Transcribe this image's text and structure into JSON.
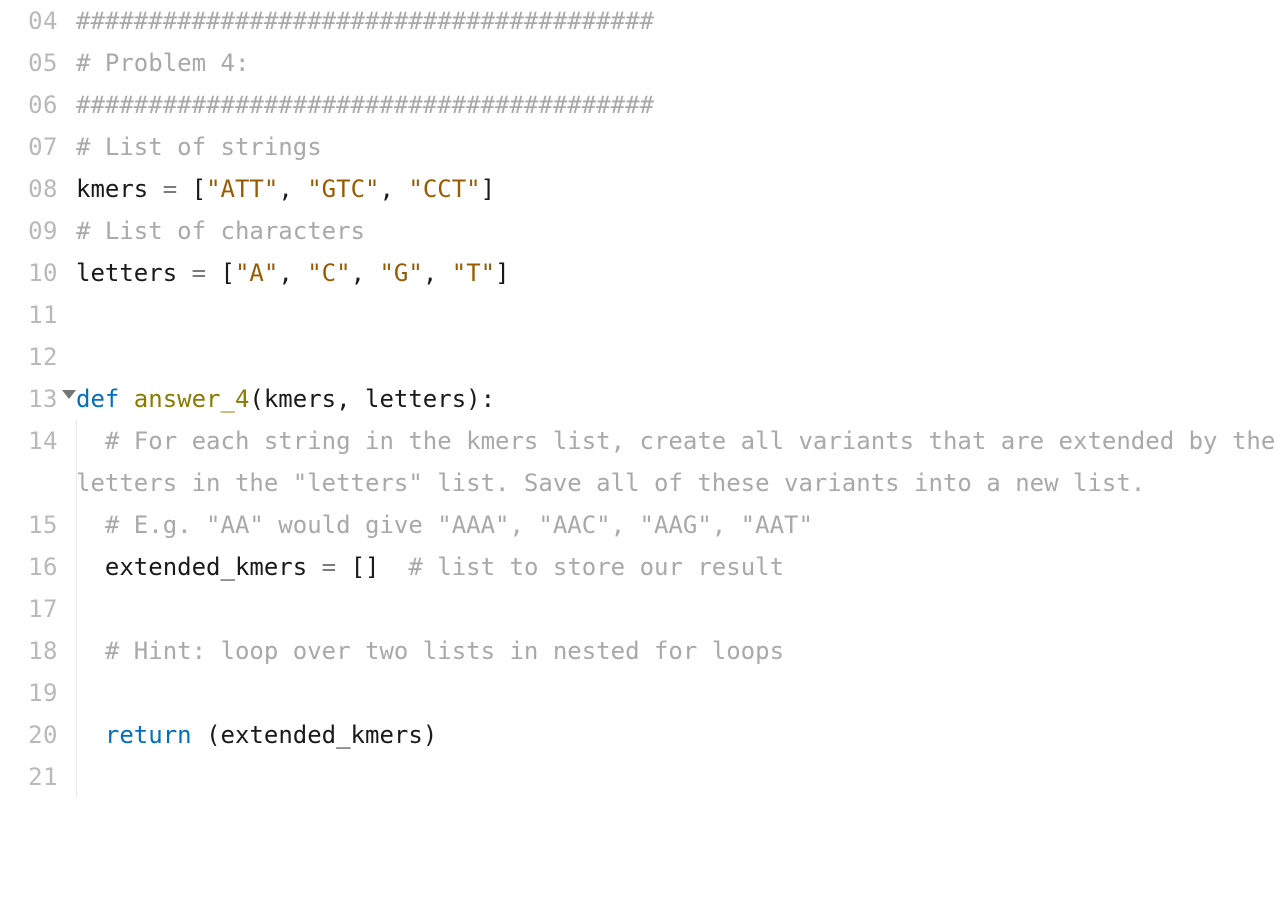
{
  "lines": [
    {
      "num": "04",
      "fold": false,
      "indent": 0,
      "tokens": [
        {
          "c": "tok-comment",
          "t": "########################################"
        }
      ]
    },
    {
      "num": "05",
      "fold": false,
      "indent": 0,
      "tokens": [
        {
          "c": "tok-comment",
          "t": "# Problem 4:"
        }
      ]
    },
    {
      "num": "06",
      "fold": false,
      "indent": 0,
      "tokens": [
        {
          "c": "tok-comment",
          "t": "########################################"
        }
      ]
    },
    {
      "num": "07",
      "fold": false,
      "indent": 0,
      "tokens": [
        {
          "c": "tok-comment",
          "t": "# List of strings"
        }
      ]
    },
    {
      "num": "08",
      "fold": false,
      "indent": 0,
      "tokens": [
        {
          "c": "tok-id",
          "t": "kmers "
        },
        {
          "c": "tok-op",
          "t": "="
        },
        {
          "c": "tok-id",
          "t": " "
        },
        {
          "c": "tok-punc",
          "t": "["
        },
        {
          "c": "tok-str",
          "t": "\"ATT\""
        },
        {
          "c": "tok-punc",
          "t": ", "
        },
        {
          "c": "tok-str",
          "t": "\"GTC\""
        },
        {
          "c": "tok-punc",
          "t": ", "
        },
        {
          "c": "tok-str",
          "t": "\"CCT\""
        },
        {
          "c": "tok-punc",
          "t": "]"
        }
      ]
    },
    {
      "num": "09",
      "fold": false,
      "indent": 0,
      "tokens": [
        {
          "c": "tok-comment",
          "t": "# List of characters"
        }
      ]
    },
    {
      "num": "10",
      "fold": false,
      "indent": 0,
      "tokens": [
        {
          "c": "tok-id",
          "t": "letters "
        },
        {
          "c": "tok-op",
          "t": "="
        },
        {
          "c": "tok-id",
          "t": " "
        },
        {
          "c": "tok-punc",
          "t": "["
        },
        {
          "c": "tok-str",
          "t": "\"A\""
        },
        {
          "c": "tok-punc",
          "t": ", "
        },
        {
          "c": "tok-str",
          "t": "\"C\""
        },
        {
          "c": "tok-punc",
          "t": ", "
        },
        {
          "c": "tok-str",
          "t": "\"G\""
        },
        {
          "c": "tok-punc",
          "t": ", "
        },
        {
          "c": "tok-str",
          "t": "\"T\""
        },
        {
          "c": "tok-punc",
          "t": "]"
        }
      ]
    },
    {
      "num": "11",
      "fold": false,
      "indent": 0,
      "tokens": [
        {
          "c": "",
          "t": ""
        }
      ]
    },
    {
      "num": "12",
      "fold": false,
      "indent": 0,
      "tokens": [
        {
          "c": "",
          "t": ""
        }
      ]
    },
    {
      "num": "13",
      "fold": true,
      "indent": 0,
      "tokens": [
        {
          "c": "tok-kw",
          "t": "def "
        },
        {
          "c": "tok-fn",
          "t": "answer_4"
        },
        {
          "c": "tok-punc",
          "t": "("
        },
        {
          "c": "tok-id",
          "t": "kmers"
        },
        {
          "c": "tok-punc",
          "t": ", "
        },
        {
          "c": "tok-id",
          "t": "letters"
        },
        {
          "c": "tok-punc",
          "t": "):"
        }
      ]
    },
    {
      "num": "14",
      "fold": false,
      "indent": 1,
      "tokens": [
        {
          "c": "tok-comment",
          "t": "# For each string in the kmers list, create all variants that are extended by the letters in the \"letters\" list. Save all of these variants into a new list."
        }
      ]
    },
    {
      "num": "15",
      "fold": false,
      "indent": 1,
      "tokens": [
        {
          "c": "tok-comment",
          "t": "# E.g. \"AA\" would give \"AAA\", \"AAC\", \"AAG\", \"AAT\""
        }
      ]
    },
    {
      "num": "16",
      "fold": false,
      "indent": 1,
      "tokens": [
        {
          "c": "tok-id",
          "t": "extended_kmers "
        },
        {
          "c": "tok-op",
          "t": "="
        },
        {
          "c": "tok-id",
          "t": " "
        },
        {
          "c": "tok-punc",
          "t": "[]"
        },
        {
          "c": "tok-id",
          "t": "  "
        },
        {
          "c": "tok-comment",
          "t": "# list to store our result"
        }
      ]
    },
    {
      "num": "17",
      "fold": false,
      "indent": 1,
      "tokens": [
        {
          "c": "",
          "t": ""
        }
      ]
    },
    {
      "num": "18",
      "fold": false,
      "indent": 1,
      "tokens": [
        {
          "c": "tok-comment",
          "t": "# Hint: loop over two lists in nested for loops"
        }
      ]
    },
    {
      "num": "19",
      "fold": false,
      "indent": 1,
      "tokens": [
        {
          "c": "",
          "t": ""
        }
      ]
    },
    {
      "num": "20",
      "fold": false,
      "indent": 1,
      "tokens": [
        {
          "c": "tok-kw",
          "t": "return"
        },
        {
          "c": "tok-id",
          "t": " "
        },
        {
          "c": "tok-punc",
          "t": "("
        },
        {
          "c": "tok-id",
          "t": "extended_kmers"
        },
        {
          "c": "tok-punc",
          "t": ")"
        }
      ]
    },
    {
      "num": "21",
      "fold": false,
      "indent": 1,
      "tokens": [
        {
          "c": "",
          "t": ""
        }
      ]
    }
  ]
}
